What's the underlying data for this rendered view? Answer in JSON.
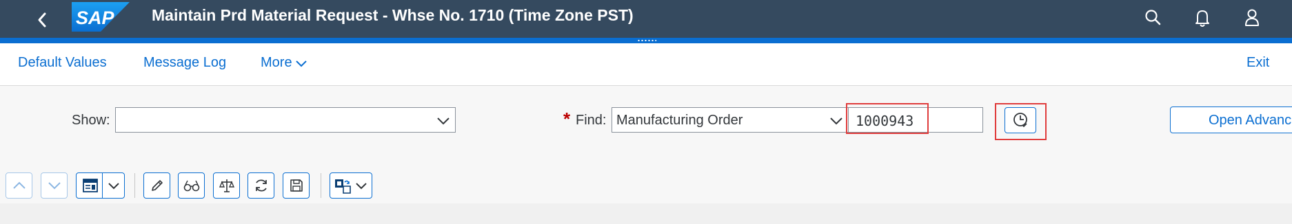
{
  "shell": {
    "title": "Maintain Prd Material Request - Whse No. 1710 (Time Zone PST)",
    "logo_text": "SAP",
    "icons": [
      "back-icon",
      "search-icon",
      "bell-icon",
      "user-icon"
    ],
    "colors": {
      "shellbar": "#354a5f",
      "accent": "#0a6ed1"
    }
  },
  "toolbar": {
    "default_values": "Default Values",
    "message_log": "Message Log",
    "more": "More",
    "exit": "Exit"
  },
  "filter": {
    "show_label": "Show:",
    "show_value": "",
    "required_marker": "*",
    "find_label": "Find:",
    "find_type": "Manufacturing Order",
    "find_value": "1000943",
    "open_advanced": "Open Advanc"
  },
  "icon_toolbar": {
    "icons": [
      "scroll-up-icon",
      "scroll-down-icon",
      "layout-icon",
      "edit-icon",
      "display-icon",
      "balance-icon",
      "refresh-icon",
      "save-icon",
      "process-icon"
    ]
  },
  "highlight_color": "#e03c3c"
}
